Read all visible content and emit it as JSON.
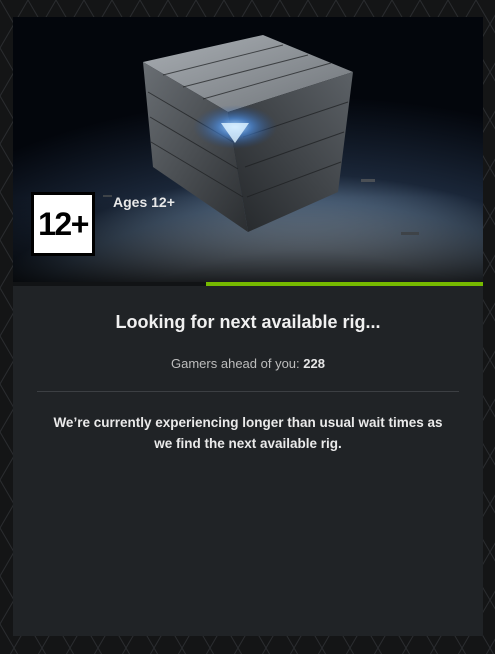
{
  "rating": {
    "badge": "12+",
    "label": "Ages 12+"
  },
  "queue": {
    "progress": 0.59,
    "title": "Looking for next available rig...",
    "position_label": "Gamers ahead of you:",
    "position_value": "228",
    "message": "We’re currently experiencing longer than usual wait times as we find the next available rig."
  },
  "colors": {
    "accent": "#76b900",
    "panel": "#202326",
    "background": "#141516"
  }
}
